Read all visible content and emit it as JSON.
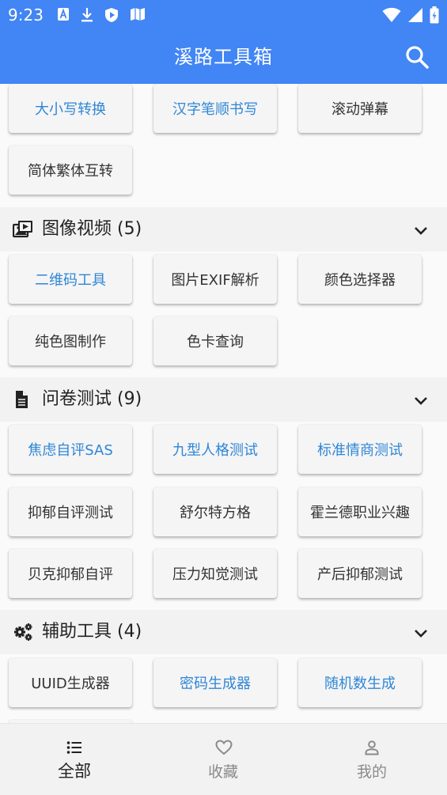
{
  "status_bar": {
    "time": "9:23",
    "icons": [
      "text-a-icon",
      "download-icon",
      "shield-play-icon",
      "map-icon",
      "wifi-icon",
      "signal-icon",
      "battery-icon"
    ]
  },
  "app_bar": {
    "title": "溪路工具箱",
    "action_icon": "search-icon"
  },
  "sections": [
    {
      "icon": "image-video-icon",
      "title": "图像视频 (5)",
      "expanded": true,
      "items": [
        "二维码工具",
        "图片EXIF解析",
        "颜色选择器",
        "纯色图制作",
        "色卡查询"
      ]
    },
    {
      "icon": "document-icon",
      "title": "问卷测试 (9)",
      "expanded": true,
      "items": [
        "焦虑自评SAS",
        "九型人格测试",
        "标准情商测试",
        "抑郁自评测试",
        "舒尔特方格",
        "霍兰德职业兴趣",
        "贝克抑郁自评",
        "压力知觉测试",
        "产后抑郁测试"
      ]
    },
    {
      "icon": "gears-icon",
      "title": "辅助工具 (4)",
      "expanded": true,
      "items": [
        "UUID生成器",
        "密码生成器",
        "随机数生成"
      ]
    }
  ],
  "previous_section_items": [
    "大小写转换",
    "汉字笔顺书写",
    "滚动弹幕",
    "简体繁体互转"
  ],
  "colors": {
    "primary": "#4285f4",
    "highlight_text": "#2f86d6",
    "chip_bg": "#f5f5f5"
  },
  "bottom_nav": [
    {
      "icon": "list-icon",
      "label": "全部",
      "active": true
    },
    {
      "icon": "heart-icon",
      "label": "收藏",
      "active": false
    },
    {
      "icon": "person-icon",
      "label": "我的",
      "active": false
    }
  ]
}
